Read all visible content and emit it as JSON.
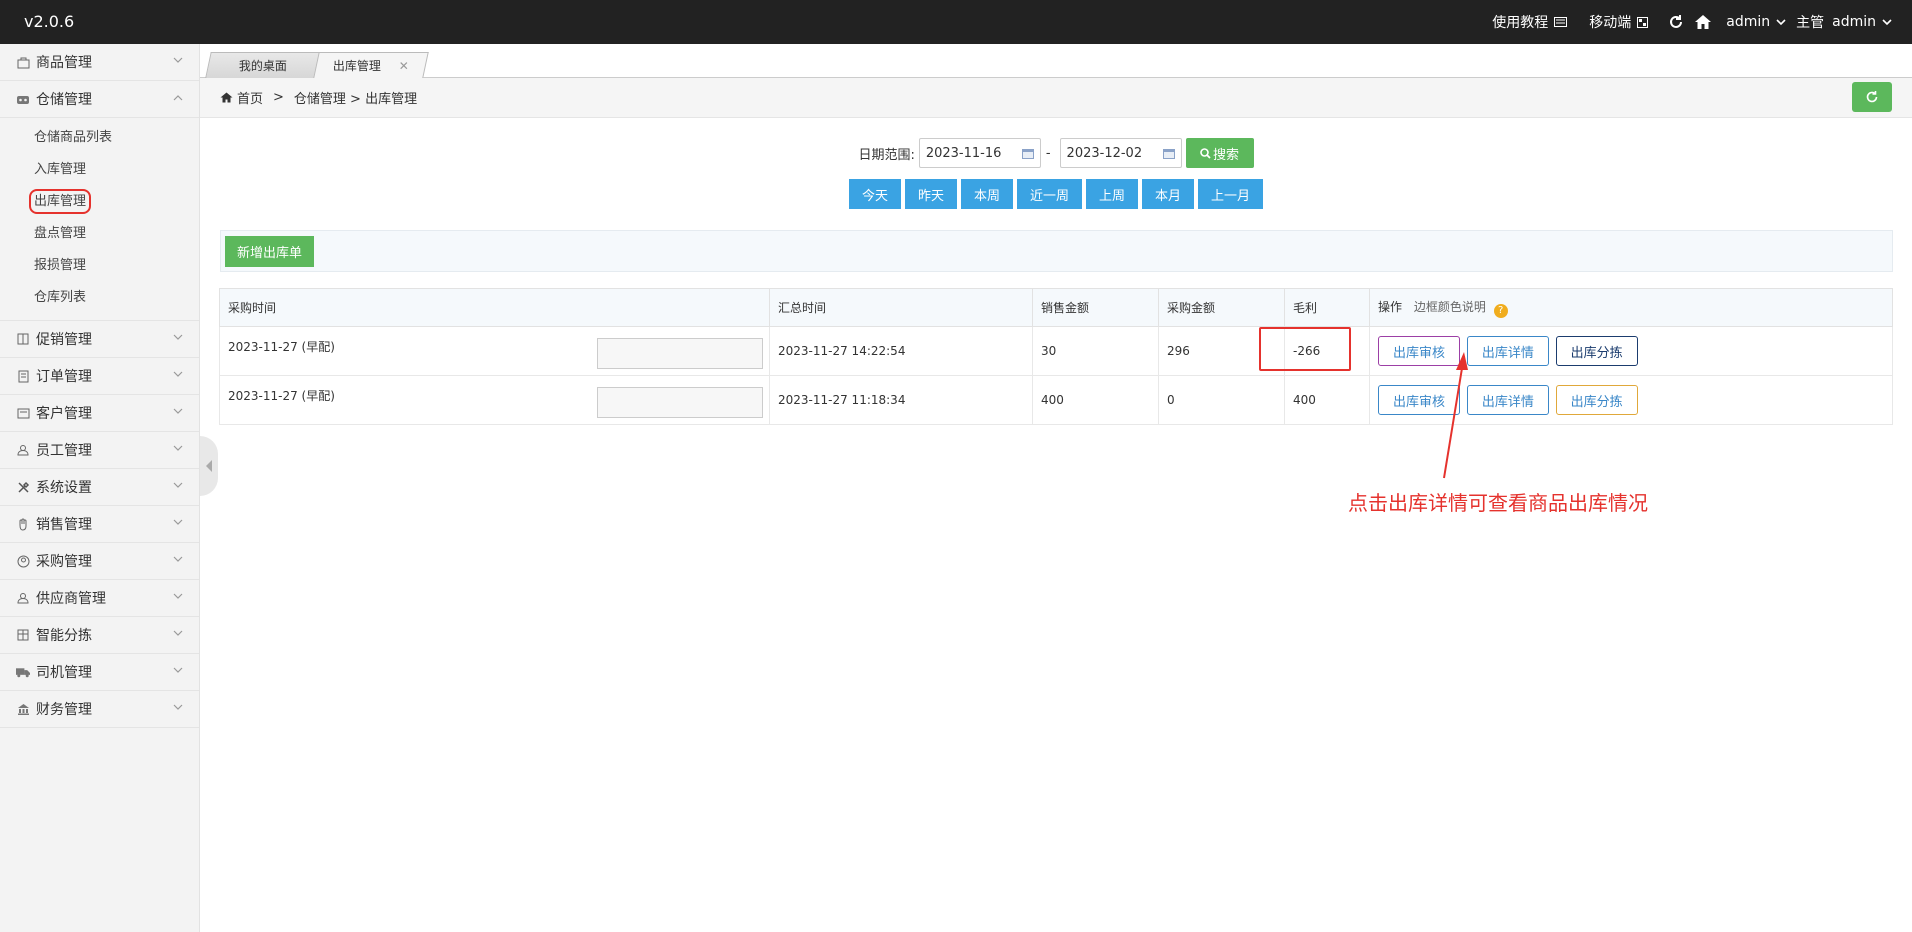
{
  "app": {
    "version": "v2.0.6"
  },
  "topbar": {
    "tutorial": "使用教程",
    "mobile": "移动端",
    "user1": "admin",
    "role": "主管",
    "user2": "admin"
  },
  "sidebar": {
    "items": [
      {
        "label": "商品管理",
        "icon": "box-icon"
      },
      {
        "label": "仓储管理",
        "icon": "warehouse-icon"
      },
      {
        "label": "促销管理",
        "icon": "promo-icon"
      },
      {
        "label": "订单管理",
        "icon": "order-icon"
      },
      {
        "label": "客户管理",
        "icon": "customer-icon"
      },
      {
        "label": "员工管理",
        "icon": "user-icon"
      },
      {
        "label": "系统设置",
        "icon": "tools-icon"
      },
      {
        "label": "销售管理",
        "icon": "hand-icon"
      },
      {
        "label": "采购管理",
        "icon": "purchase-icon"
      },
      {
        "label": "供应商管理",
        "icon": "supplier-icon"
      },
      {
        "label": "智能分拣",
        "icon": "sorting-icon"
      },
      {
        "label": "司机管理",
        "icon": "truck-icon"
      },
      {
        "label": "财务管理",
        "icon": "finance-icon"
      }
    ],
    "sub": [
      "仓储商品列表",
      "入库管理",
      "出库管理",
      "盘点管理",
      "报损管理",
      "仓库列表"
    ]
  },
  "tabs": [
    "我的桌面",
    "出库管理"
  ],
  "breadcrumb": {
    "home": "首页",
    "sep": ">",
    "level1": "仓储管理 > 出库管理"
  },
  "filter": {
    "label": "日期范围:",
    "start": "2023-11-16",
    "end": "2023-12-02",
    "dash": "-",
    "search": "搜索",
    "quick": [
      "今天",
      "昨天",
      "本周",
      "近一周",
      "上周",
      "本月",
      "上一月"
    ]
  },
  "toolbar": {
    "add": "新增出库单"
  },
  "table": {
    "headers": [
      "采购时间",
      "汇总时间",
      "销售金额",
      "采购金额",
      "毛利",
      "操作"
    ],
    "op_note": "边框颜色说明",
    "help": "?",
    "rows": [
      {
        "purchase_time": "2023-11-27 (早配)",
        "summary_time": "2023-11-27 14:22:54",
        "sales": "30",
        "cost": "296",
        "profit": "-266"
      },
      {
        "purchase_time": "2023-11-27 (早配)",
        "summary_time": "2023-11-27 11:18:34",
        "sales": "400",
        "cost": "0",
        "profit": "400"
      }
    ],
    "ops": {
      "audit": "出库审核",
      "detail": "出库详情",
      "split": "出库分拣"
    }
  },
  "annotation": {
    "text": "点击出库详情可查看商品出库情况"
  },
  "colors": {
    "topbar": "#222222",
    "green": "#5cb85c",
    "blue": "#3aa3e3",
    "red": "#e5322d"
  }
}
